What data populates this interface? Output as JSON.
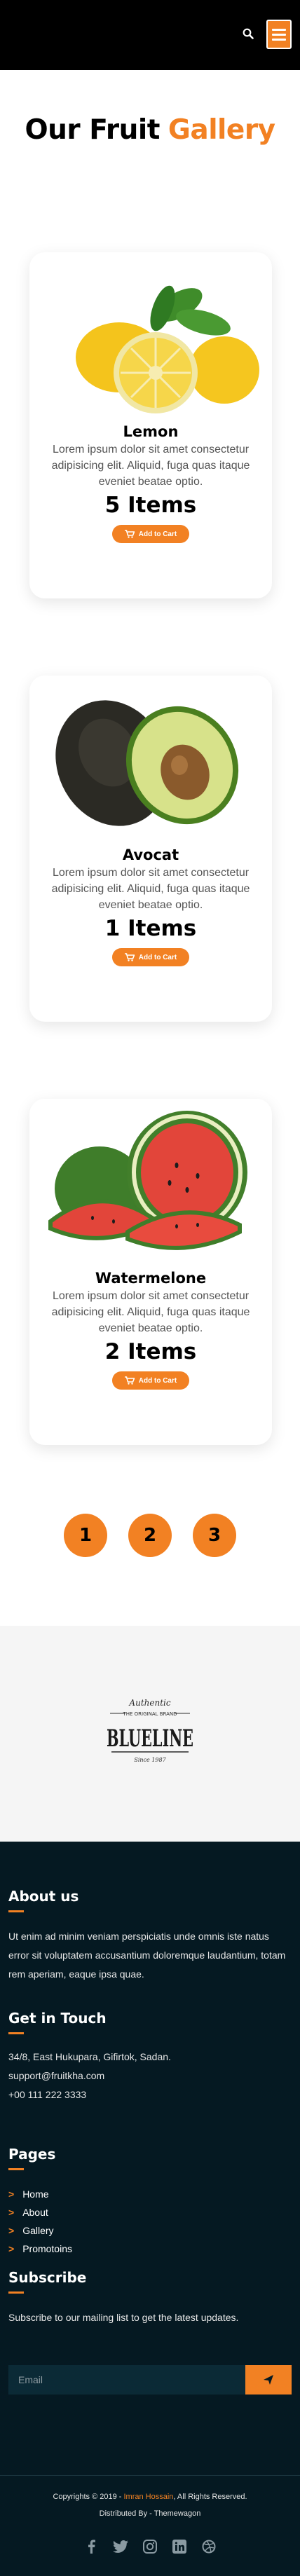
{
  "header": {
    "search_icon": "search-icon",
    "menu_icon": "hamburger-menu-icon",
    "accent": "#F28123"
  },
  "title": {
    "part1": "Our Fruit",
    "part2": "Gallery"
  },
  "products": [
    {
      "name": "Lemon",
      "desc": "Lorem ipsum dolor sit amet consectetur adipisicing elit. Aliquid, fuga quas itaque eveniet beatae optio.",
      "qty": "5 Items",
      "button": "Add to Cart"
    },
    {
      "name": "Avocat",
      "desc": "Lorem ipsum dolor sit amet consectetur adipisicing elit. Aliquid, fuga quas itaque eveniet beatae optio.",
      "qty": "1 Items",
      "button": "Add to Cart"
    },
    {
      "name": "Watermelone",
      "desc": "Lorem ipsum dolor sit amet consectetur adipisicing elit. Aliquid, fuga quas itaque eveniet beatae optio.",
      "qty": "2 Items",
      "button": "Add to Cart"
    }
  ],
  "pagination": [
    "1",
    "2",
    "3"
  ],
  "brand": {
    "top": "Authentic",
    "sub": "THE ORIGINAL BRAND",
    "name": "BLUELINE",
    "since": "Since 1987"
  },
  "footer": {
    "about_title": "About us",
    "about_text": "Ut enim ad minim veniam perspiciatis unde omnis iste natus error sit voluptatem accusantium doloremque laudantium, totam rem aperiam, eaque ipsa quae.",
    "touch_title": "Get in Touch",
    "address": "34/8, East Hukupara, Gifirtok, Sadan.",
    "email": "support@fruitkha.com",
    "phone": "+00 111 222 3333",
    "pages_title": "Pages",
    "pages": [
      "Home",
      "About",
      "Gallery",
      "Promotoins"
    ],
    "subscribe_title": "Subscribe",
    "subscribe_text": "Subscribe to our mailing list to get the  latest updates.",
    "email_placeholder": "Email",
    "copyright_pre": "Copyrights © 2019 - ",
    "copyright_name": "Imran Hossain",
    "copyright_post": ", All Rights Reserved.",
    "distributed": "Distributed By - Themewagon"
  }
}
